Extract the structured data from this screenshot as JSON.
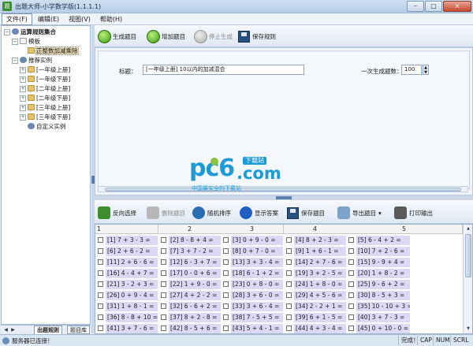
{
  "window": {
    "title": "出题大师-小学数学版(1.1.1.1)",
    "icon_glyph": "题",
    "minimize": "–",
    "maximize": "□",
    "close": "×"
  },
  "menu": {
    "file": "文件(F)",
    "edit": "编辑(E)",
    "view": "视图(V)",
    "help": "帮助(H)"
  },
  "tree": {
    "root": "运算规则集合",
    "template": "模板",
    "template_child": "正整数加减乘除",
    "recommended": "推荐实例",
    "grades": [
      "[一年级上册]",
      "[一年级下册]",
      "[二年级上册]",
      "[二年级下册]",
      "[三年级上册]",
      "[三年级下册]"
    ],
    "custom": "自定义实例",
    "expand_open": "−",
    "expand_closed": "+"
  },
  "tree_tabs": {
    "active": "出题规则",
    "other": "题目库",
    "nav_left": "◀",
    "nav_right": "▶"
  },
  "toolbar1": {
    "generate": "生成题目",
    "add": "增加题目",
    "stop": "停止生成",
    "save_rule": "保存规则"
  },
  "config": {
    "title_label": "标题：",
    "title_value": "[一年级上册] 10以内的加减混合",
    "count_label": "一次生成题数：",
    "count_value": "100",
    "spin_up": "▲",
    "spin_down": "▼"
  },
  "logo": {
    "pc": "pc6",
    "com": ".com",
    "badge": "下载站",
    "sub": "中国最安全的下载站"
  },
  "toolbar2": {
    "reverse": "反向选择",
    "delete": "删除题目",
    "shuffle": "随机排序",
    "show_answer": "显示答案",
    "save_questions": "保存题目",
    "export": "导出题目",
    "print": "打印输出",
    "dropdown": "▾"
  },
  "grid": {
    "columns": [
      "1",
      "2",
      "3",
      "4",
      "5"
    ],
    "rows": [
      [
        "[1] 7 + 3 - 3 =",
        "[2] 8 - 8 + 4 =",
        "[3] 0 + 9 - 0 =",
        "[4] 8 + 2 - 3 =",
        "[5] 6 - 4 + 2 ="
      ],
      [
        "[6] 2 + 6 - 2 =",
        "[7] 3 + 7 - 2 =",
        "[8] 0 + 7 - 0 =",
        "[9] 1 + 6 - 1 =",
        "[10] 7 + 2 - 6 ="
      ],
      [
        "[11] 2 + 6 - 6 =",
        "[12] 6 - 3 + 7 =",
        "[13] 3 + 3 - 4 =",
        "[14] 2 + 7 - 6 =",
        "[15] 9 - 9 + 4 ="
      ],
      [
        "[16] 4 - 4 + 7 =",
        "[17] 0 - 0 + 6 =",
        "[18] 6 - 1 + 2 =",
        "[19] 3 + 2 - 5 =",
        "[20] 1 + 8 - 2 ="
      ],
      [
        "[21] 3 - 2 + 3 =",
        "[22] 1 + 9 - 0 =",
        "[23] 0 + 8 - 0 =",
        "[24] 1 + 8 - 0 =",
        "[25] 9 - 6 + 2 ="
      ],
      [
        "[26] 0 + 9 - 4 =",
        "[27] 4 + 2 - 2 =",
        "[28] 3 + 6 - 0 =",
        "[29] 4 + 5 - 6 =",
        "[30] 8 - 5 + 3 ="
      ],
      [
        "[31] 1 + 8 - 1 =",
        "[32] 6 - 6 + 2 =",
        "[33] 3 + 6 - 4 =",
        "[34] 2 - 2 + 1 =",
        "[35] 10 - 10 + 3 ="
      ],
      [
        "[36] 8 - 8 + 10 =",
        "[37] 8 + 2 - 8 =",
        "[38] 7 - 5 + 5 =",
        "[39] 6 + 1 - 5 =",
        "[40] 3 + 7 - 3 ="
      ],
      [
        "[41] 3 + 7 - 6 =",
        "[42] 8 - 5 + 6 =",
        "[43] 5 + 4 - 1 =",
        "[44] 4 + 3 - 4 =",
        "[45] 0 + 10 - 0 ="
      ]
    ]
  },
  "status": {
    "left": "服务器已连接！",
    "ready": "完成！",
    "cap": "CAP",
    "num": "NUM",
    "scrl": "SCRL"
  },
  "scroll": {
    "up": "▲",
    "down": "▼"
  },
  "colors": {
    "accent": "#1e9bd7",
    "grid_highlight": "#dcd8f6",
    "frame": "#dfe8f3"
  }
}
